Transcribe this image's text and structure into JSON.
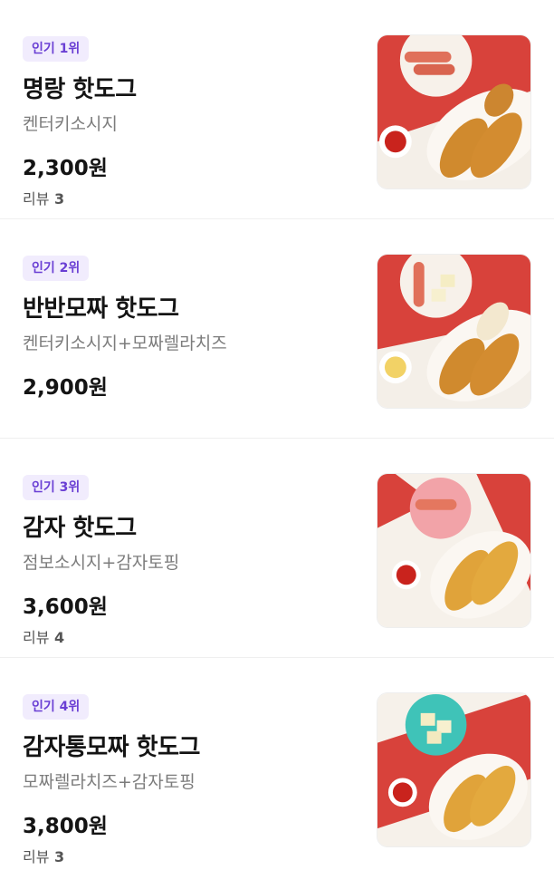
{
  "items": [
    {
      "rank": "인기 1위",
      "name": "명랑 핫도그",
      "desc": "켄터키소시지",
      "price": "2,300원",
      "review_label": "리뷰",
      "review_count": "3"
    },
    {
      "rank": "인기 2위",
      "name": "반반모짜 핫도그",
      "desc": "켄터키소시지+모짜렐라치즈",
      "price": "2,900원"
    },
    {
      "rank": "인기 3위",
      "name": "감자 핫도그",
      "desc": "점보소시지+감자토핑",
      "price": "3,600원",
      "review_label": "리뷰",
      "review_count": "4"
    },
    {
      "rank": "인기 4위",
      "name": "감자통모짜 핫도그",
      "desc": "모짜렐라치즈+감자토핑",
      "price": "3,800원",
      "review_label": "리뷰",
      "review_count": "3"
    }
  ],
  "colors": {
    "badge_bg": "#f1ecfd",
    "badge_text": "#6a3fd4",
    "photo_red": "#d8423b"
  },
  "icons": [
    "hotdog-photo",
    "mozzarella-hotdog-photo",
    "potato-hotdog-photo",
    "potato-mozzarella-hotdog-photo"
  ]
}
